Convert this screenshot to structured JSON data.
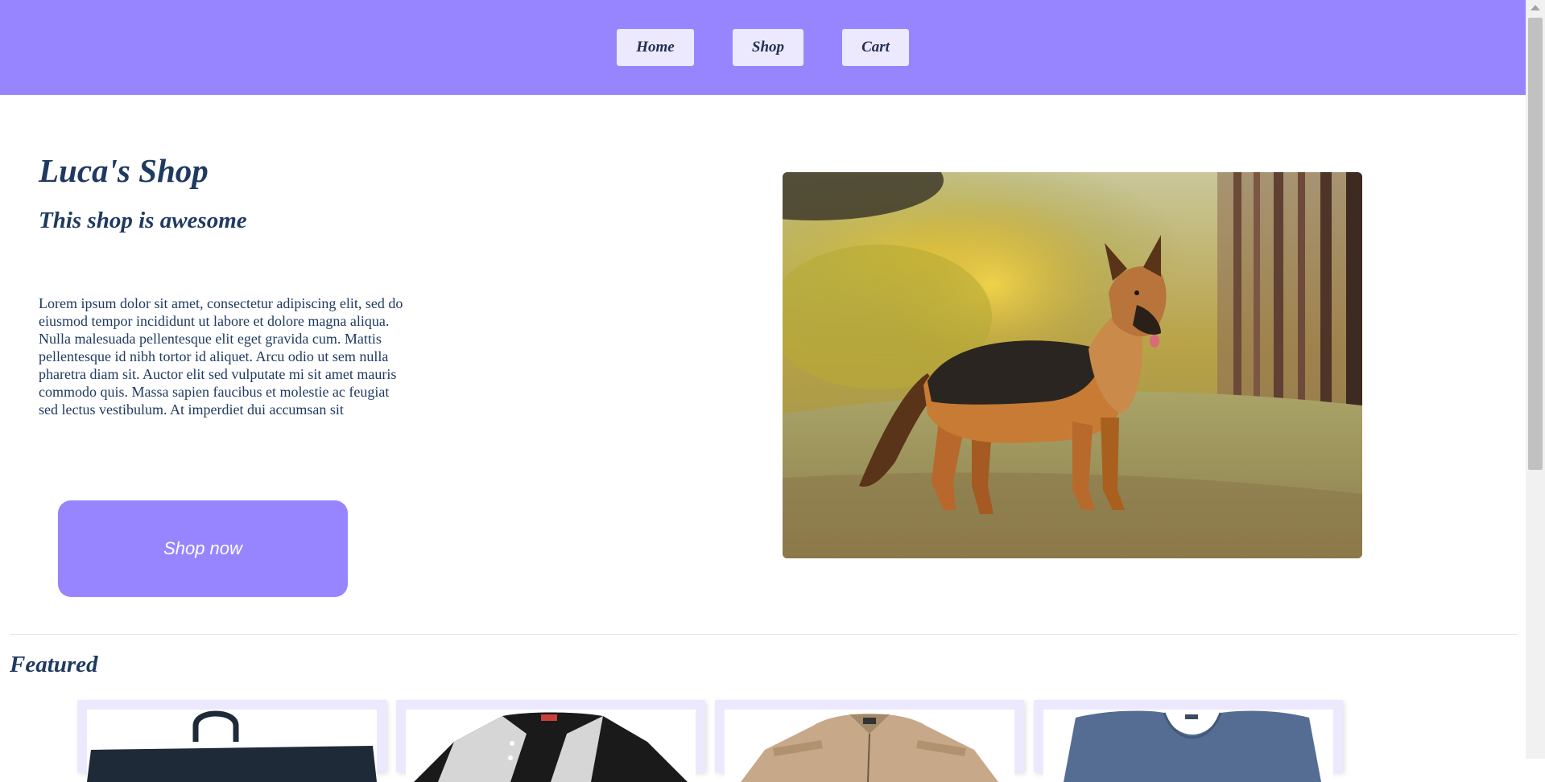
{
  "nav": {
    "items": [
      {
        "label": "Home"
      },
      {
        "label": "Shop"
      },
      {
        "label": "Cart"
      }
    ]
  },
  "hero": {
    "title": "Luca's Shop",
    "subtitle": "This shop is awesome",
    "body": "Lorem ipsum dolor sit amet, consectetur adipiscing elit, sed do eiusmod tempor incididunt ut labore et dolore magna aliqua. Nulla malesuada pellentesque elit eget gravida cum. Mattis pellentesque id nibh tortor id aliquet. Arcu odio ut sem nulla pharetra diam sit. Auctor elit sed vulputate mi sit amet mauris commodo quis. Massa sapien faucibus et molestie ac feugiat sed lectus vestibulum. At imperdiet dui accumsan sit",
    "cta_label": "Shop now",
    "image_icon": "dog-photo"
  },
  "featured": {
    "title": "Featured",
    "products": [
      {
        "icon": "bag-icon"
      },
      {
        "icon": "raglan-shirt-icon"
      },
      {
        "icon": "jacket-icon"
      },
      {
        "icon": "tshirt-icon"
      }
    ]
  },
  "colors": {
    "accent": "#9785ff",
    "nav_button_bg": "#ece9ff",
    "heading_text": "#1f3a60"
  }
}
